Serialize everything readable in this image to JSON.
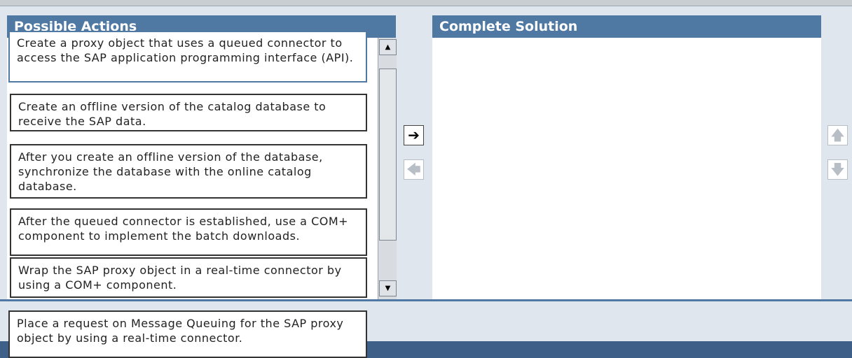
{
  "panels": {
    "left_title": "Possible Actions",
    "right_title": "Complete Solution"
  },
  "actions": [
    {
      "text": "Create a proxy object that uses a queued connector to access the SAP application programming interface (API)."
    },
    {
      "text": "Create an offline version of the catalog database to receive the SAP data."
    },
    {
      "text": "After you create an offline version of the database, synchronize the database with the online catalog database."
    },
    {
      "text": "After the queued connector is established, use a COM+ component to implement the batch downloads."
    },
    {
      "text": "Wrap the SAP proxy object in a real-time connector by using a COM+ component."
    },
    {
      "text": "Place a request on Message Queuing for the SAP proxy object by using a real-time connector."
    }
  ],
  "icons": {
    "move_right": "arrow-right-icon",
    "move_left": "arrow-left-icon",
    "move_up": "arrow-up-icon",
    "move_down": "arrow-down-icon",
    "scroll_up": "scroll-up-icon",
    "scroll_down": "scroll-down-icon"
  },
  "colors": {
    "header": "#4f78a3",
    "background": "#dfe6ee",
    "footer": "#3e5f87"
  }
}
